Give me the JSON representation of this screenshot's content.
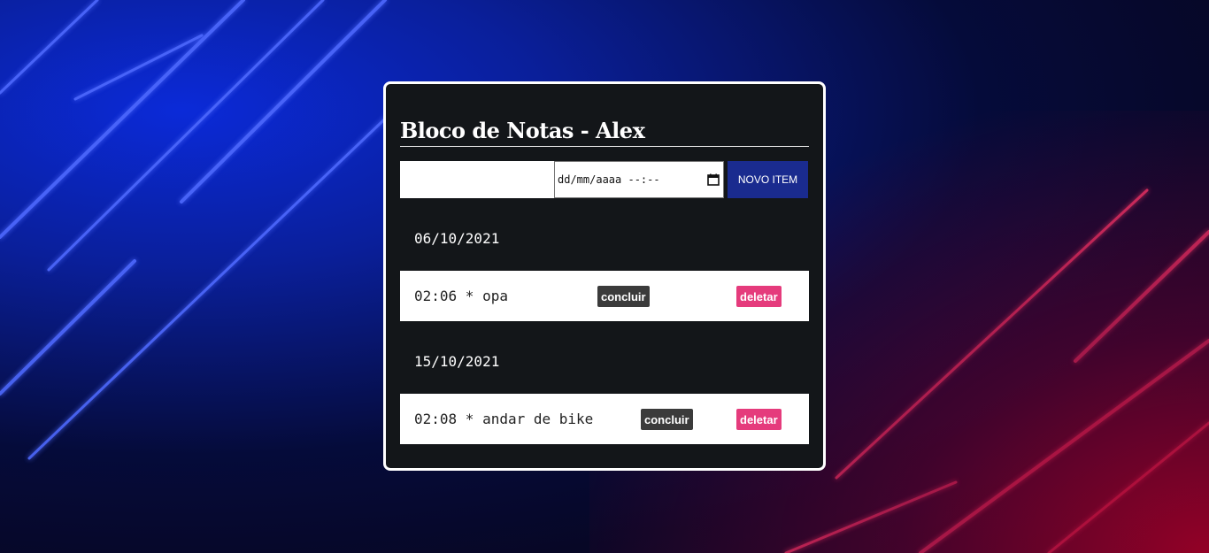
{
  "app": {
    "title": "Bloco de Notas - Alex"
  },
  "form": {
    "text_value": "",
    "date_placeholder": "dd/mm/aaaa --:--",
    "new_item_label": "NOVO ITEM"
  },
  "groups": [
    {
      "date": "06/10/2021",
      "items": [
        {
          "text": "02:06 * opa",
          "conclude_label": "concluir",
          "delete_label": "deletar"
        }
      ]
    },
    {
      "date": "15/10/2021",
      "items": [
        {
          "text": "02:08 * andar de bike",
          "conclude_label": "concluir",
          "delete_label": "deletar"
        }
      ]
    }
  ],
  "icons": {
    "date_picker": "calendar-icon"
  },
  "colors": {
    "card_bg": "#131619",
    "new_item_button": "#1a2b8f",
    "conclude_button": "#3b3b3b",
    "delete_button": "#e53b7c"
  }
}
